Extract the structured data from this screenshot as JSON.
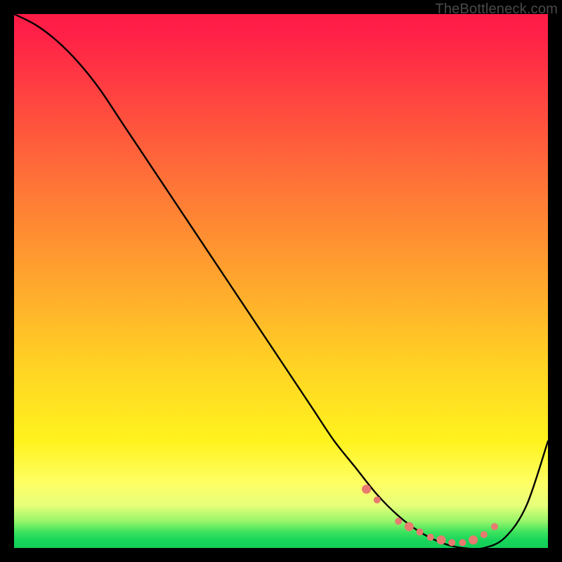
{
  "watermark": "TheBottleneck.com",
  "colors": {
    "curve": "#000000",
    "dots": "#e87a6f",
    "frame": "#000000"
  },
  "chart_data": {
    "type": "line",
    "title": "",
    "xlabel": "",
    "ylabel": "",
    "xlim": [
      0,
      100
    ],
    "ylim": [
      0,
      100
    ],
    "grid": false,
    "legend": false,
    "series": [
      {
        "name": "bottleneck-curve",
        "x": [
          0,
          4,
          8,
          12,
          16,
          20,
          24,
          28,
          32,
          36,
          40,
          44,
          48,
          52,
          56,
          60,
          64,
          68,
          72,
          76,
          80,
          84,
          88,
          92,
          96,
          100
        ],
        "y": [
          100,
          98,
          95,
          91,
          86,
          80,
          74,
          68,
          62,
          56,
          50,
          44,
          38,
          32,
          26,
          20,
          15,
          10,
          6,
          3,
          1,
          0,
          0,
          2,
          8,
          20
        ]
      }
    ],
    "highlight_points": {
      "name": "optimal-range-dots",
      "x": [
        66,
        68,
        72,
        74,
        76,
        78,
        80,
        82,
        84,
        86,
        88,
        90
      ],
      "y": [
        11,
        9,
        5,
        4,
        3,
        2,
        1.5,
        1,
        1,
        1.5,
        2.5,
        4
      ]
    }
  }
}
